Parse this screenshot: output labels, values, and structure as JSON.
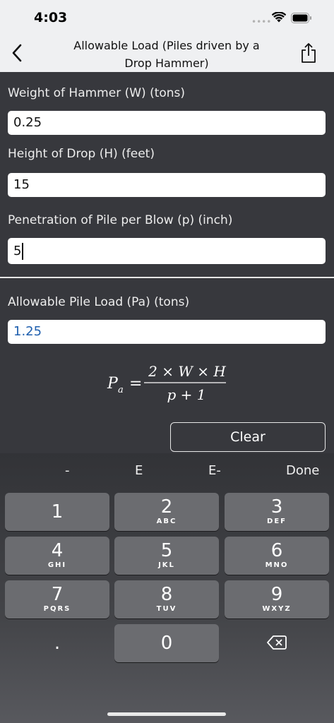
{
  "status_bar": {
    "time": "4:03"
  },
  "nav": {
    "title": "Allowable Load (Piles driven by a Drop Hammer)"
  },
  "form": {
    "weight_label": "Weight of Hammer (W) (tons)",
    "weight_value": "0.25",
    "height_label": "Height of Drop (H) (feet)",
    "height_value": "15",
    "penetration_label": "Penetration of Pile per Blow (p) (inch)",
    "penetration_value": "5",
    "result_label": "Allowable Pile Load (Pa) (tons)",
    "result_value": "1.25"
  },
  "formula": {
    "lhs": "P",
    "lhs_sub": "a",
    "numerator": "2 × W × H",
    "denominator": "p + 1"
  },
  "clear_label": "Clear",
  "keyboard": {
    "toolbar": [
      "-",
      "E",
      "E-",
      "Done"
    ],
    "keys": [
      {
        "num": "1",
        "letters": ""
      },
      {
        "num": "2",
        "letters": "ABC"
      },
      {
        "num": "3",
        "letters": "DEF"
      },
      {
        "num": "4",
        "letters": "GHI"
      },
      {
        "num": "5",
        "letters": "JKL"
      },
      {
        "num": "6",
        "letters": "MNO"
      },
      {
        "num": "7",
        "letters": "PQRS"
      },
      {
        "num": "8",
        "letters": "TUV"
      },
      {
        "num": "9",
        "letters": "WXYZ"
      },
      {
        "num": ".",
        "letters": ""
      },
      {
        "num": "0",
        "letters": ""
      }
    ]
  },
  "colors": {
    "result_text": "#1f5fae",
    "key": "#6b6c70",
    "nav_bg": "#eff0f2"
  }
}
